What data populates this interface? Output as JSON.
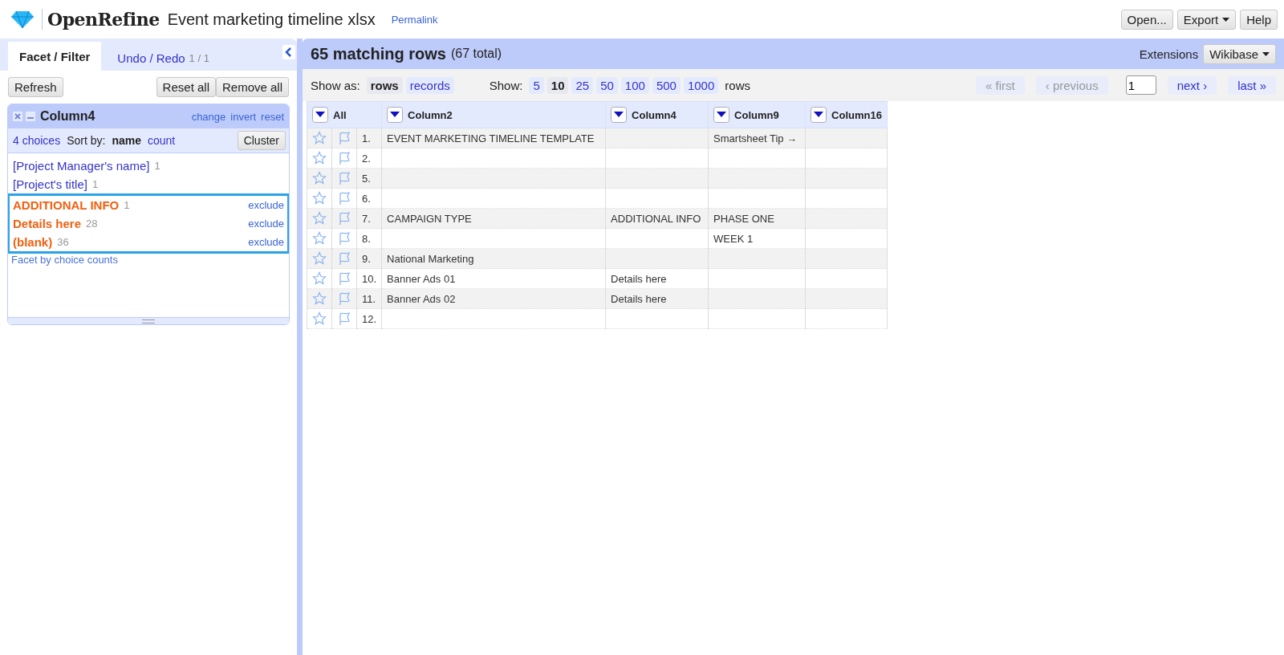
{
  "header": {
    "logo": "OpenRefine",
    "project": "Event marketing timeline xlsx",
    "permalink": "Permalink",
    "buttons": [
      {
        "label": "Open...",
        "dropdown": false
      },
      {
        "label": "Export",
        "dropdown": true
      },
      {
        "label": "Help",
        "dropdown": false
      }
    ]
  },
  "left_panel": {
    "tabs": [
      {
        "label": "Facet / Filter",
        "selected": true
      },
      {
        "label": "Undo / Redo",
        "count": "1 / 1",
        "selected": false
      }
    ],
    "buttons": {
      "refresh": "Refresh",
      "reset_all": "Reset all",
      "remove_all": "Remove all"
    },
    "facet": {
      "title": "Column4",
      "links": [
        "change",
        "invert",
        "reset"
      ],
      "choice_count": "4 choices",
      "sort_label": "Sort by:",
      "sort_options": [
        {
          "label": "name",
          "selected": true
        },
        {
          "label": "count",
          "selected": false
        }
      ],
      "cluster": "Cluster",
      "choices": [
        {
          "label": "[Project Manager's name]",
          "count": "1",
          "selected": false
        },
        {
          "label": "[Project's title]",
          "count": "1",
          "selected": false
        },
        {
          "label": "ADDITIONAL INFO",
          "count": "1",
          "selected": true,
          "action": "exclude"
        },
        {
          "label": "Details here",
          "count": "28",
          "selected": true,
          "action": "exclude"
        },
        {
          "label": "(blank)",
          "count": "36",
          "selected": true,
          "action": "exclude"
        }
      ],
      "footer_link": "Facet by choice counts"
    }
  },
  "main": {
    "title": "65 matching rows",
    "total": "(67 total)",
    "extensions_label": "Extensions",
    "extensions_button": "Wikibase",
    "show_as_label": "Show as:",
    "show_as": [
      {
        "label": "rows",
        "selected": true
      },
      {
        "label": "records",
        "selected": false
      }
    ],
    "show_label": "Show:",
    "page_sizes": [
      {
        "label": "5",
        "selected": false
      },
      {
        "label": "10",
        "selected": true
      },
      {
        "label": "25",
        "selected": false
      },
      {
        "label": "50",
        "selected": false
      },
      {
        "label": "100",
        "selected": false
      },
      {
        "label": "500",
        "selected": false
      },
      {
        "label": "1000",
        "selected": false
      }
    ],
    "rows_label": "rows",
    "pager": {
      "first": {
        "label": "« first",
        "disabled": true
      },
      "previous": {
        "label": "‹ previous",
        "disabled": true
      },
      "page": "1",
      "next": {
        "label": "next ›",
        "disabled": false
      },
      "last": {
        "label": "last »",
        "disabled": false
      }
    },
    "table": {
      "all_label": "All",
      "columns": [
        "Column2",
        "Column4",
        "Column9",
        "Column16"
      ],
      "rows": [
        {
          "number": "1.",
          "cells": [
            "EVENT MARKETING TIMELINE TEMPLATE",
            null,
            "Smartsheet Tip →",
            null
          ]
        },
        {
          "number": "2.",
          "cells": [
            null,
            null,
            null,
            null
          ]
        },
        {
          "number": "5.",
          "cells": [
            null,
            null,
            null,
            null
          ]
        },
        {
          "number": "6.",
          "cells": [
            null,
            null,
            null,
            null
          ]
        },
        {
          "number": "7.",
          "cells": [
            "CAMPAIGN TYPE",
            "ADDITIONAL INFO",
            "PHASE ONE",
            null
          ]
        },
        {
          "number": "8.",
          "cells": [
            null,
            null,
            "WEEK 1",
            null
          ]
        },
        {
          "number": "9.",
          "cells": [
            "National Marketing",
            null,
            null,
            null
          ]
        },
        {
          "number": "10.",
          "cells": [
            "Banner Ads 01",
            "Details here",
            null,
            null
          ]
        },
        {
          "number": "11.",
          "cells": [
            "Banner Ads 02",
            "Details here",
            null,
            null
          ]
        },
        {
          "number": "12.",
          "cells": [
            null,
            null,
            null,
            null
          ]
        }
      ]
    }
  }
}
